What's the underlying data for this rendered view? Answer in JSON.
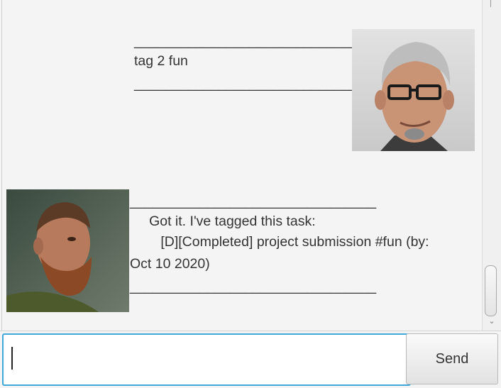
{
  "chat": {
    "user_message": {
      "top_rule": "________________________________",
      "text": "tag 2 fun",
      "bottom_rule": "________________________________",
      "avatar_icon": "user-avatar-icon"
    },
    "bot_message": {
      "top_rule": "________________________________",
      "line1": "     Got it. I've tagged this task:",
      "line2": "        [D][Completed] project submission #fun (by:",
      "line3": "Oct 10 2020)",
      "bottom_rule": "________________________________",
      "avatar_icon": "bot-avatar-icon"
    }
  },
  "input": {
    "value": "",
    "placeholder": ""
  },
  "send_label": "Send",
  "colors": {
    "input_focus_border": "#3ea8d8",
    "background": "#f4f4f4"
  }
}
